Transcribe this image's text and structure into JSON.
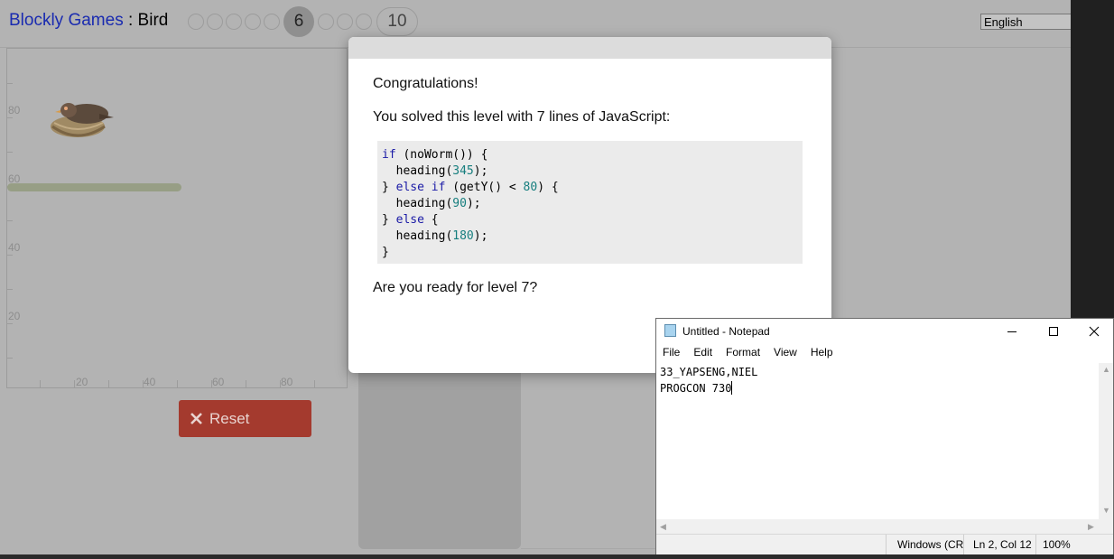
{
  "app": {
    "title": "Blockly Games",
    "separator": " : ",
    "game": "Bird"
  },
  "levels": {
    "current": "6",
    "last": "10"
  },
  "language": "English",
  "canvas": {
    "y_labels": [
      "80",
      "60",
      "40",
      "20"
    ],
    "x_labels": [
      "20",
      "40",
      "60",
      "80"
    ]
  },
  "reset_button": "Reset",
  "dialog": {
    "heading": "Congratulations!",
    "message": "You solved this level with 7 lines of JavaScript:",
    "code_lines": [
      "if (noWorm()) {",
      "  heading(345);",
      "} else if (getY() < 80) {",
      "  heading(90);",
      "} else {",
      "  heading(180);",
      "}"
    ],
    "prompt": "Are you ready for level 7?"
  },
  "notepad": {
    "title": "Untitled - Notepad",
    "menu": [
      "File",
      "Edit",
      "Format",
      "View",
      "Help"
    ],
    "lines": [
      "33_YAPSENG,NIEL",
      "PROGCON 730"
    ],
    "status": {
      "eol": "Windows (CR",
      "position": "Ln 2, Col 12",
      "zoom": "100%"
    }
  }
}
